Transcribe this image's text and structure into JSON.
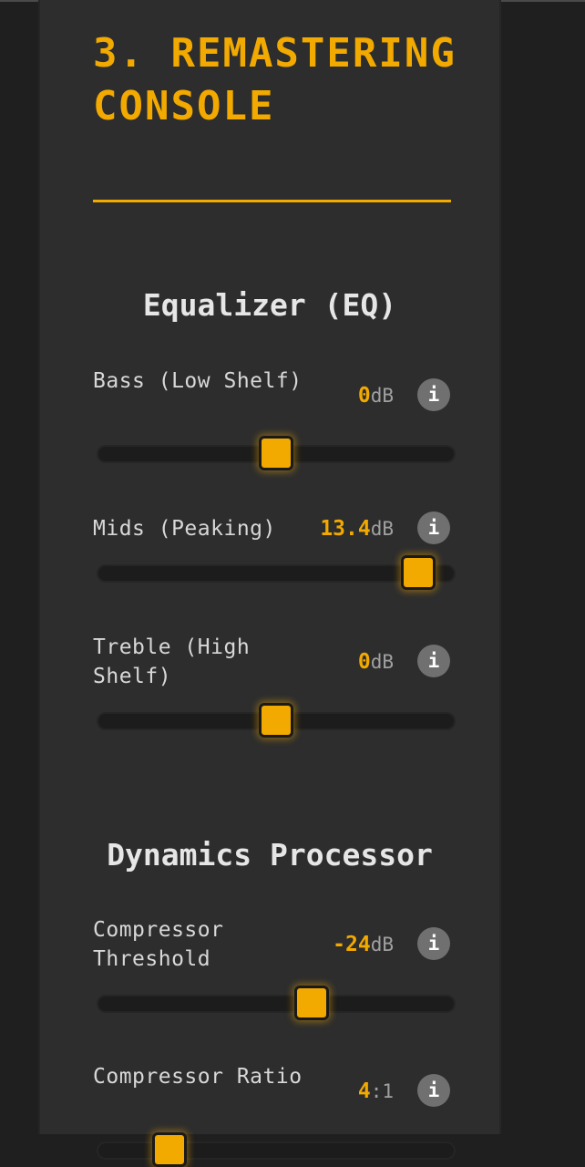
{
  "section_title": "3. REMASTERING CONSOLE",
  "eq": {
    "heading": "Equalizer (EQ)",
    "controls": [
      {
        "label": "Bass (Low Shelf)",
        "value": "0",
        "unit": "dB",
        "slider_fraction": 0.5
      },
      {
        "label": "Mids (Peaking)",
        "value": "13.4",
        "unit": "dB",
        "slider_fraction": 0.9
      },
      {
        "label": "Treble (High Shelf)",
        "value": "0",
        "unit": "dB",
        "slider_fraction": 0.5
      }
    ]
  },
  "dynamics": {
    "heading": "Dynamics Processor",
    "controls": [
      {
        "label": "Compressor Threshold",
        "value": "-24",
        "unit": "dB",
        "slider_fraction": 0.6
      },
      {
        "label": "Compressor Ratio",
        "value": "4",
        "unit": ":1",
        "slider_fraction": 0.2
      }
    ]
  },
  "info_symbol": "i",
  "colors": {
    "accent": "#f2a900",
    "panel": "#2d2d2d",
    "background": "#1f1f1f",
    "track": "#1c1c1c",
    "info_button": "#707070"
  }
}
